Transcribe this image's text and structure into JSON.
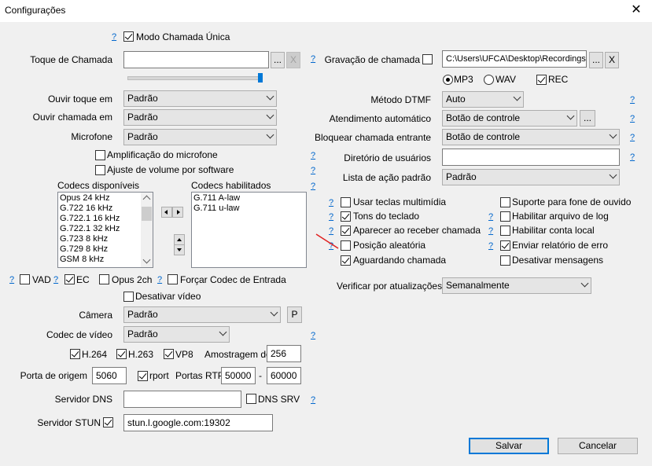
{
  "window": {
    "title": "Configurações"
  },
  "colors": {
    "help_link": "#0066cc",
    "accent": "#0078d7",
    "annotation": "#e02020"
  },
  "help_symbol": "?",
  "top": {
    "modo_chamada_unica": {
      "label": "Modo Chamada Única",
      "checked": true
    }
  },
  "toque": {
    "label": "Toque de Chamada",
    "value": "",
    "browse": "...",
    "clear": "X"
  },
  "ouvir_toque": {
    "label": "Ouvir toque em",
    "value": "Padrão"
  },
  "ouvir_chamada": {
    "label": "Ouvir chamada em",
    "value": "Padrão"
  },
  "microfone": {
    "label": "Microfone",
    "value": "Padrão"
  },
  "amplificacao": {
    "label": "Amplificação do microfone",
    "checked": false
  },
  "ajuste_volume": {
    "label": "Ajuste de volume por software",
    "checked": false
  },
  "codecs": {
    "available_label": "Codecs disponíveis",
    "enabled_label": "Codecs habilitados",
    "available": [
      "Opus 24 kHz",
      "G.722 16 kHz",
      "G.722.1 16 kHz",
      "G.722.1 32 kHz",
      "G.723 8 kHz",
      "G.729 8 kHz",
      "GSM 8 kHz"
    ],
    "enabled": [
      "G.711 A-law",
      "G.711 u-law"
    ]
  },
  "codec_options": {
    "vad": {
      "label": "VAD",
      "checked": false
    },
    "ec": {
      "label": "EC",
      "checked": true
    },
    "opus2ch": {
      "label": "Opus 2ch",
      "checked": false
    },
    "forcar": {
      "label": "Forçar Codec de Entrada",
      "checked": false
    }
  },
  "desativar_video": {
    "label": "Desativar vídeo",
    "checked": false
  },
  "camera": {
    "label": "Câmera",
    "value": "Padrão",
    "button": "P"
  },
  "codec_video": {
    "label": "Codec de vídeo",
    "value": "Padrão"
  },
  "video_codecs": {
    "h264": {
      "label": "H.264",
      "checked": true
    },
    "h263": {
      "label": "H.263",
      "checked": true
    },
    "vp8": {
      "label": "VP8",
      "checked": true
    },
    "amostragem_label": "Amostragem do",
    "amostragem_value": "256"
  },
  "porta": {
    "label": "Porta de origem",
    "value": "5060",
    "rport_label": "rport",
    "rport_checked": true,
    "rtp_label": "Portas RTP",
    "rtp_from": "50000",
    "dash": "-",
    "rtp_to": "60000"
  },
  "dns": {
    "label": "Servidor DNS",
    "value": "",
    "srv_label": "DNS SRV",
    "srv_checked": false
  },
  "stun": {
    "label": "Servidor STUN",
    "checked": true,
    "value": "stun.l.google.com:19302"
  },
  "gravacao": {
    "label": "Gravação de chamada",
    "checked": false,
    "path": "C:\\Users\\UFCA\\Desktop\\Recordings",
    "browse": "...",
    "clear": "X",
    "mp3": {
      "label": "MP3",
      "selected": true
    },
    "wav": {
      "label": "WAV",
      "selected": false
    },
    "rec": {
      "label": "REC",
      "checked": true
    }
  },
  "dtmf": {
    "label": "Método DTMF",
    "value": "Auto"
  },
  "atendimento": {
    "label": "Atendimento automático",
    "value": "Botão de controle",
    "button": "..."
  },
  "bloquear": {
    "label": "Bloquear chamada entrante",
    "value": "Botão de controle"
  },
  "diretorio": {
    "label": "Diretório de usuários",
    "value": ""
  },
  "lista_acao": {
    "label": "Lista de ação padrão",
    "value": "Padrão"
  },
  "options_left": [
    {
      "label": "Usar teclas multimídia",
      "checked": false
    },
    {
      "label": "Tons do teclado",
      "checked": true
    },
    {
      "label": "Aparecer ao receber chamada",
      "checked": true
    },
    {
      "label": "Posição aleatória",
      "checked": false
    },
    {
      "label": "Aguardando chamada",
      "checked": true
    }
  ],
  "options_right": [
    {
      "label": "Suporte para fone de ouvido",
      "checked": false
    },
    {
      "label": "Habilitar arquivo de log",
      "checked": false
    },
    {
      "label": "Habilitar conta local",
      "checked": false
    },
    {
      "label": "Enviar relatório de erro",
      "checked": true
    },
    {
      "label": "Desativar mensagens",
      "checked": false
    }
  ],
  "atualizacoes": {
    "label": "Verificar por atualizações",
    "value": "Semanalmente"
  },
  "footer": {
    "save": "Salvar",
    "cancel": "Cancelar"
  }
}
